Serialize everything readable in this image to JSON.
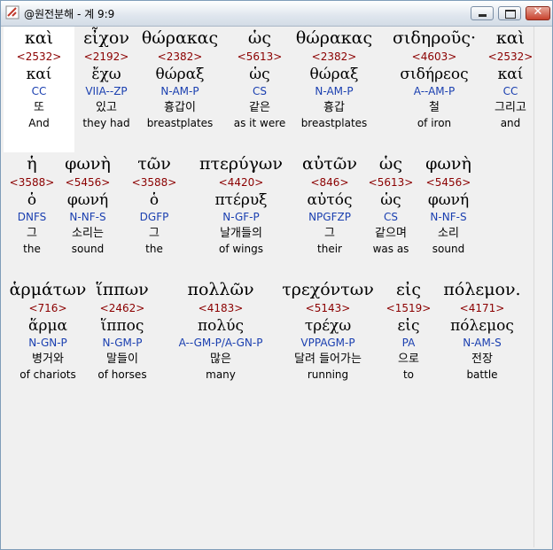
{
  "window": {
    "title": "@원전분해 - 계 9:9",
    "close_label": "✕"
  },
  "rows": [
    [
      {
        "greek": "καὶ",
        "strong": "<2532>",
        "lemma": "καί",
        "parse": "CC",
        "korean": "또",
        "english": "And"
      },
      {
        "greek": "εἶχον",
        "strong": "<2192>",
        "lemma": "ἔχω",
        "parse": "VIIA--ZP",
        "korean": "있고",
        "english": "they had"
      },
      {
        "greek": "θώρακας",
        "strong": "<2382>",
        "lemma": "θώραξ",
        "parse": "N-AM-P",
        "korean": "흉갑이",
        "english": "breastplates"
      },
      {
        "greek": "ὡς",
        "strong": "<5613>",
        "lemma": "ὡς",
        "parse": "CS",
        "korean": "같은",
        "english": "as it were"
      },
      {
        "greek": "θώρακας",
        "strong": "<2382>",
        "lemma": "θώραξ",
        "parse": "N-AM-P",
        "korean": "흉갑",
        "english": "breastplates"
      },
      {
        "greek": "σιδηροῦς·",
        "strong": "<4603>",
        "lemma": "σιδήρεος",
        "parse": "A--AM-P",
        "korean": "철",
        "english": "of iron"
      },
      {
        "greek": "καὶ",
        "strong": "<2532>",
        "lemma": "καί",
        "parse": "CC",
        "korean": "그리고",
        "english": "and"
      }
    ],
    [
      {
        "greek": "ἡ",
        "strong": "<3588>",
        "lemma": "ὁ",
        "parse": "DNFS",
        "korean": "그",
        "english": "the"
      },
      {
        "greek": "φωνὴ",
        "strong": "<5456>",
        "lemma": "φωνή",
        "parse": "N-NF-S",
        "korean": "소리는",
        "english": "sound"
      },
      {
        "greek": "τῶν",
        "strong": "<3588>",
        "lemma": "ὁ",
        "parse": "DGFP",
        "korean": "그",
        "english": "the"
      },
      {
        "greek": "πτερύγων",
        "strong": "<4420>",
        "lemma": "πτέρυξ",
        "parse": "N-GF-P",
        "korean": "날개들의",
        "english": "of wings"
      },
      {
        "greek": "αὐτῶν",
        "strong": "<846>",
        "lemma": "αὐτός",
        "parse": "NPGFZP",
        "korean": "그",
        "english": "their"
      },
      {
        "greek": "ὡς",
        "strong": "<5613>",
        "lemma": "ὡς",
        "parse": "CS",
        "korean": "같으며",
        "english": "was as"
      },
      {
        "greek": "φωνὴ",
        "strong": "<5456>",
        "lemma": "φωνή",
        "parse": "N-NF-S",
        "korean": "소리",
        "english": "sound"
      }
    ],
    [
      {
        "greek": "ἁρμάτων",
        "strong": "<716>",
        "lemma": "ἅρμα",
        "parse": "N-GN-P",
        "korean": "병거와",
        "english": "of chariots"
      },
      {
        "greek": "ἵππων",
        "strong": "<2462>",
        "lemma": "ἵππος",
        "parse": "N-GM-P",
        "korean": "말들이",
        "english": "of horses"
      },
      {
        "greek": "πολλῶν",
        "strong": "<4183>",
        "lemma": "πολύς",
        "parse": "A--GM-P/A-GN-P",
        "korean": "많은",
        "english": "many"
      },
      {
        "greek": "τρεχόντων",
        "strong": "<5143>",
        "lemma": "τρέχω",
        "parse": "VPPAGM-P",
        "korean": "달려 들어가는",
        "english": "running"
      },
      {
        "greek": "εἰς",
        "strong": "<1519>",
        "lemma": "εἰς",
        "parse": "PA",
        "korean": "으로",
        "english": "to"
      },
      {
        "greek": "πόλεμον.",
        "strong": "<4171>",
        "lemma": "πόλεμος",
        "parse": "N-AM-S",
        "korean": "전장",
        "english": "battle"
      }
    ]
  ]
}
